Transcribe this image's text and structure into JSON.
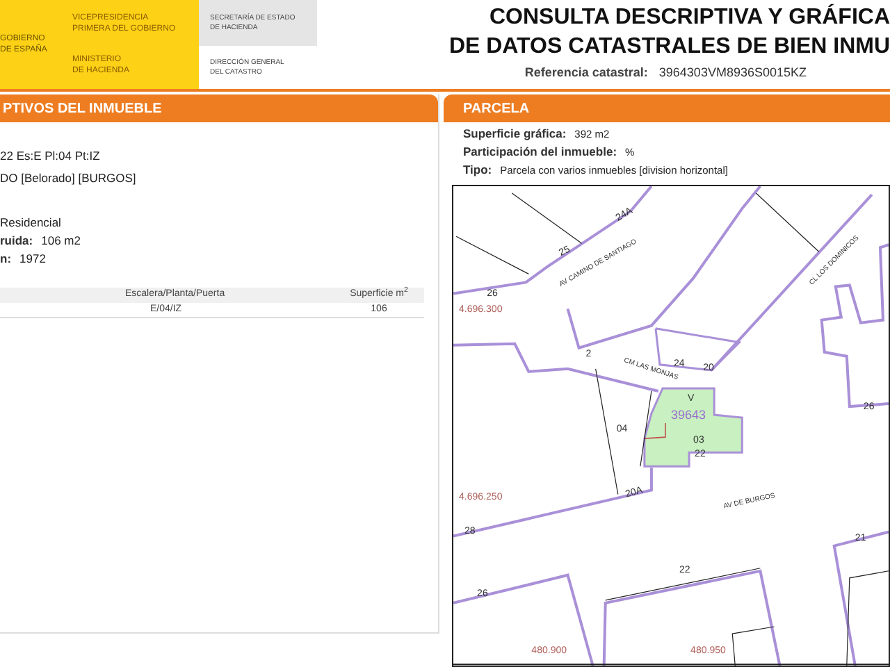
{
  "header": {
    "logo_left": [
      "GOBIERNO",
      "DE ESPAÑA"
    ],
    "logo_vice": [
      "VICEPRESIDENCIA",
      "PRIMERA DEL GOBIERNO"
    ],
    "logo_ministry": [
      "MINISTERIO",
      "DE HACIENDA"
    ],
    "secretaria": [
      "SECRETARÍA DE ESTADO",
      "DE HACIENDA"
    ],
    "direccion": [
      "DIRECCIÓN GENERAL",
      "DEL CATASTRO"
    ],
    "title_lines": [
      "CONSULTA DESCRIPTIVA Y GRÁFICA",
      "DE DATOS CATASTRALES DE BIEN INMU"
    ],
    "reference_label": "Referencia catastral:",
    "reference_value": "3964303VM8936S0015KZ"
  },
  "left_panel": {
    "title": "PTIVOS DEL INMUEBLE",
    "address_lines": [
      "22 Es:E Pl:04 Pt:IZ",
      "DO [Belorado] [BURGOS]"
    ],
    "fields": [
      {
        "value": "Residencial"
      },
      {
        "label": "ruida:",
        "value": "106 m2"
      },
      {
        "label": "n:",
        "value": "1972"
      }
    ],
    "table": {
      "columns": [
        "Escalera/Planta/Puerta",
        "Superficie m$^{2}$"
      ],
      "rows": [
        [
          "E/04/IZ",
          "106"
        ]
      ]
    }
  },
  "right_panel": {
    "title": "PARCELA",
    "fields": [
      {
        "label": "Superficie gráfica:",
        "value": "392 m2"
      },
      {
        "label": "Participación del inmueble:",
        "value": "%"
      },
      {
        "label": "Tipo:",
        "value": "Parcela con varios inmuebles [division horizontal]"
      }
    ],
    "map": {
      "labels": [
        {
          "text": "26",
          "kind": "number"
        },
        {
          "text": "25",
          "kind": "number"
        },
        {
          "text": "24A",
          "kind": "number"
        },
        {
          "text": "AV CAMINO DE SANTIAGO",
          "kind": "street"
        },
        {
          "text": "4.696.300",
          "kind": "coord"
        },
        {
          "text": "2",
          "kind": "number"
        },
        {
          "text": "CM LAS MONJAS",
          "kind": "street"
        },
        {
          "text": "24",
          "kind": "number"
        },
        {
          "text": "20",
          "kind": "number"
        },
        {
          "text": "CL LOS DOMINICOS",
          "kind": "street"
        },
        {
          "text": "26",
          "kind": "number"
        },
        {
          "text": "V",
          "kind": "number"
        },
        {
          "text": "39643",
          "kind": "parcel"
        },
        {
          "text": "04",
          "kind": "number"
        },
        {
          "text": "03",
          "kind": "number"
        },
        {
          "text": "22",
          "kind": "number"
        },
        {
          "text": "4.696.250",
          "kind": "coord"
        },
        {
          "text": "20A",
          "kind": "number"
        },
        {
          "text": "AV DE BURGOS",
          "kind": "street"
        },
        {
          "text": "28",
          "kind": "number"
        },
        {
          "text": "26",
          "kind": "number"
        },
        {
          "text": "22",
          "kind": "number"
        },
        {
          "text": "21",
          "kind": "number"
        },
        {
          "text": "480.900",
          "kind": "coord"
        },
        {
          "text": "480.950",
          "kind": "coord"
        }
      ]
    }
  }
}
